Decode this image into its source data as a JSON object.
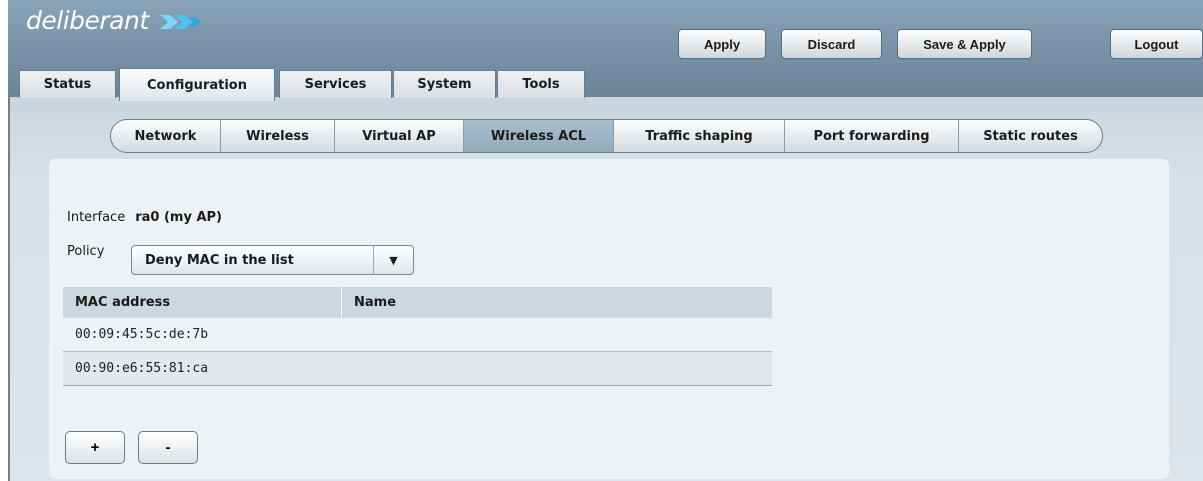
{
  "brand": {
    "logo_text": "deliberant",
    "accent_color": "#8ee0ff"
  },
  "header": {
    "apply_label": "Apply",
    "discard_label": "Discard",
    "save_apply_label": "Save & Apply",
    "logout_label": "Logout"
  },
  "main_tabs": [
    {
      "label": "Status",
      "active": false
    },
    {
      "label": "Configuration",
      "active": true
    },
    {
      "label": "Services",
      "active": false
    },
    {
      "label": "System",
      "active": false
    },
    {
      "label": "Tools",
      "active": false
    }
  ],
  "sub_tabs": [
    {
      "label": "Network",
      "active": false
    },
    {
      "label": "Wireless",
      "active": false
    },
    {
      "label": "Virtual AP",
      "active": false
    },
    {
      "label": "Wireless ACL",
      "active": true
    },
    {
      "label": "Traffic shaping",
      "active": false
    },
    {
      "label": "Port forwarding",
      "active": false
    },
    {
      "label": "Static routes",
      "active": false
    }
  ],
  "acl": {
    "interface_label": "Interface",
    "interface_value": "ra0 (my AP)",
    "policy_label": "Policy",
    "policy_value": "Deny MAC in the list",
    "columns": [
      "MAC address",
      "Name"
    ],
    "rows": [
      {
        "mac": "00:09:45:5c:de:7b",
        "name": ""
      },
      {
        "mac": "00:90:e6:55:81:ca",
        "name": ""
      }
    ],
    "add_label": "+",
    "remove_label": "-"
  },
  "icons": {
    "dropdown": "chevron-down-icon",
    "logo_arrows": "double-chevron-right-icon"
  }
}
